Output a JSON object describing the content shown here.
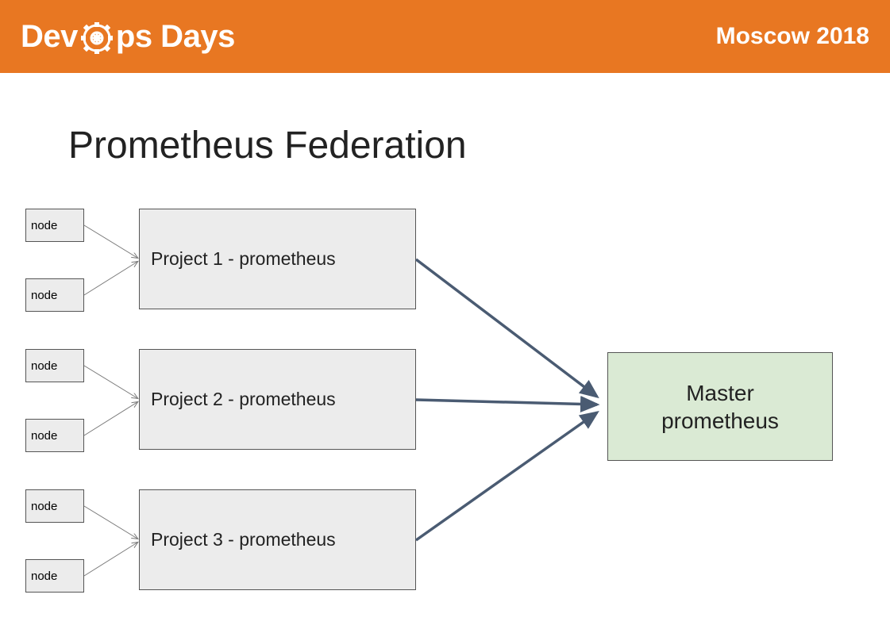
{
  "header": {
    "brand_prefix": "Dev",
    "brand_suffix": "ps Days",
    "location_year": "Moscow 2018"
  },
  "slide": {
    "title": "Prometheus Federation"
  },
  "nodes": {
    "n1": "node",
    "n2": "node",
    "n3": "node",
    "n4": "node",
    "n5": "node",
    "n6": "node"
  },
  "projects": {
    "p1": "Project 1 - prometheus",
    "p2": "Project 2 - prometheus",
    "p3": "Project 3 - prometheus"
  },
  "master": {
    "label": "Master\nprometheus"
  },
  "colors": {
    "header_bg": "#e87722",
    "box_bg": "#ececec",
    "master_bg": "#daead4",
    "arrow": "#4a5b72"
  }
}
